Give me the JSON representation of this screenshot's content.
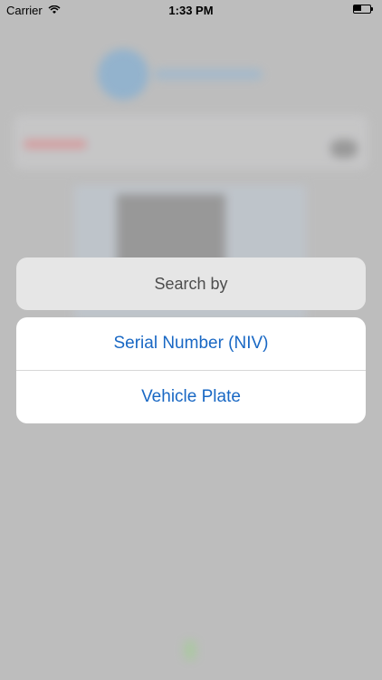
{
  "status_bar": {
    "carrier": "Carrier",
    "time": "1:33 PM",
    "wifi_icon": "wifi-icon",
    "battery_icon": "battery-icon"
  },
  "action_sheet": {
    "title": "Search by",
    "options": [
      {
        "label": "Serial Number (NIV)"
      },
      {
        "label": "Vehicle Plate"
      }
    ]
  },
  "colors": {
    "option_text": "#1968c4",
    "title_text": "#4d4d4d",
    "overlay": "#bdbdbd"
  }
}
